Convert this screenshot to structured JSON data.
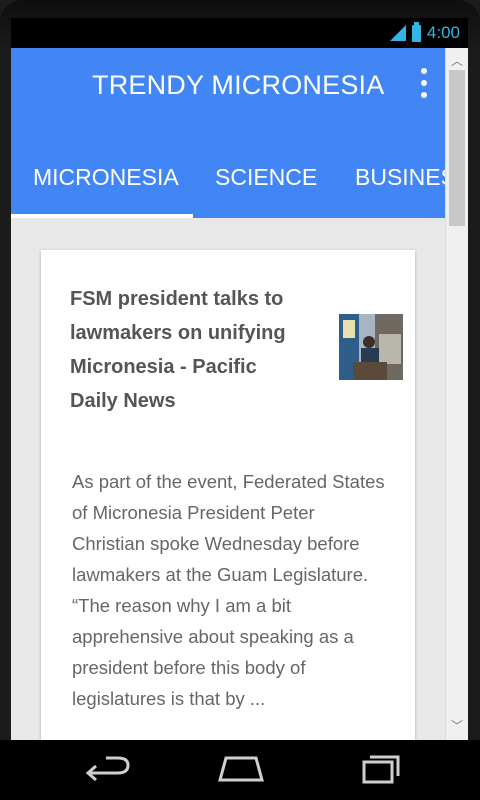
{
  "status_bar": {
    "time": "4:00",
    "icons": [
      "signal-icon",
      "battery-icon"
    ],
    "accent_color": "#33b5e5"
  },
  "app_bar": {
    "title": "TRENDY MICRONESIA",
    "menu_icon": "overflow-menu-icon",
    "color": "#4285f4"
  },
  "tabs": [
    {
      "label": "MICRONESIA",
      "selected": true
    },
    {
      "label": "SCIENCE",
      "selected": false
    },
    {
      "label": "BUSINES",
      "selected": false
    }
  ],
  "article": {
    "title": "FSM president talks to lawmakers on unifying Micronesia - Pacific Daily News",
    "thumbnail_icon": "article-thumbnail",
    "body": "As part of the event, Federated States of Micronesia President Peter Christian spoke Wednesday before lawmakers at the Guam Legislature. “The reason why I am a bit apprehensive about speaking as a president before this body of legislatures is that by ..."
  },
  "nav_bar": {
    "icons": [
      "back-icon",
      "home-icon",
      "recents-icon"
    ]
  }
}
